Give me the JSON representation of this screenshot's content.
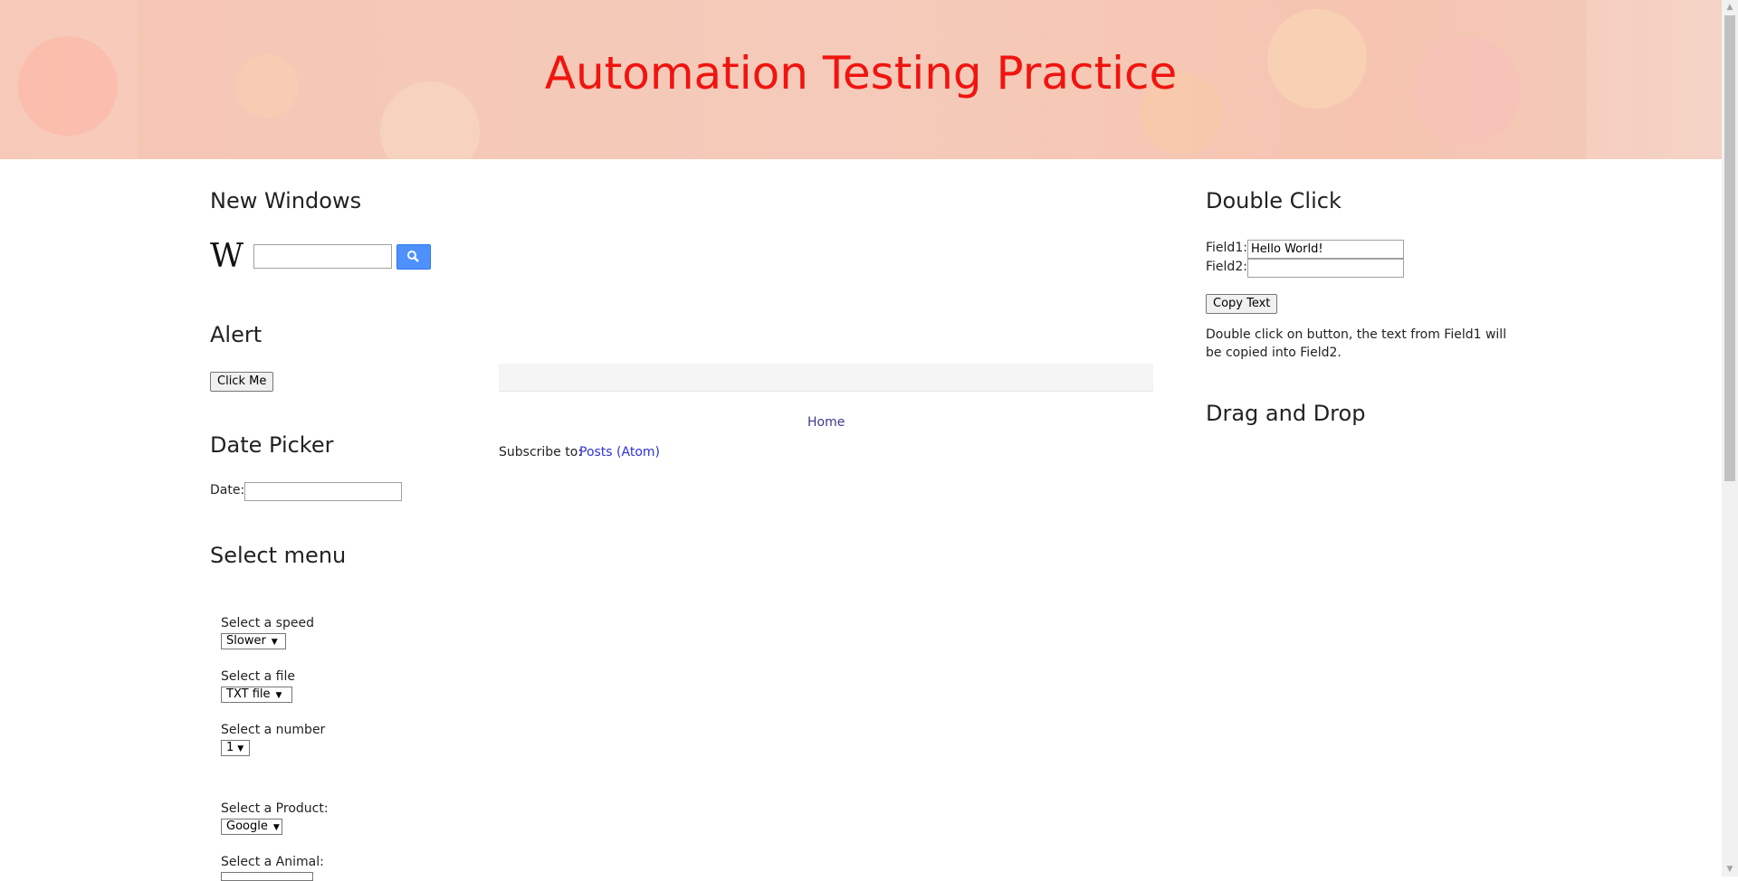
{
  "header": {
    "title": "Automation Testing Practice"
  },
  "new_windows": {
    "title": "New Windows",
    "logo_letter": "W",
    "search_value": "",
    "search_icon": "search-icon"
  },
  "alert": {
    "title": "Alert",
    "button_label": "Click Me"
  },
  "date_picker": {
    "title": "Date Picker",
    "label": "Date:",
    "value": ""
  },
  "select_menu": {
    "title": "Select menu",
    "speed": {
      "label": "Select a speed",
      "value": "Slower"
    },
    "file": {
      "label": "Select a file",
      "value": "TXT file"
    },
    "number": {
      "label": "Select a number",
      "value": "1"
    },
    "product": {
      "label": "Select a Product:",
      "value": "Google"
    },
    "animal": {
      "label": "Select a Animal:",
      "value": ""
    }
  },
  "main": {
    "home_link": "Home",
    "subscribe_label": "Subscribe to:",
    "subscribe_link": "Posts (Atom)"
  },
  "double_click": {
    "title": "Double Click",
    "field1_label": "Field1:",
    "field1_value": "Hello World!",
    "field2_label": "Field2:",
    "field2_value": "",
    "button_label": "Copy Text",
    "description": "Double click on button, the text from Field1 will be copied into Field2."
  },
  "drag_drop": {
    "title": "Drag and Drop"
  },
  "colors": {
    "title_red": "#f0140f",
    "link_blue": "#2b32d6",
    "search_blue": "#4d90fe"
  }
}
